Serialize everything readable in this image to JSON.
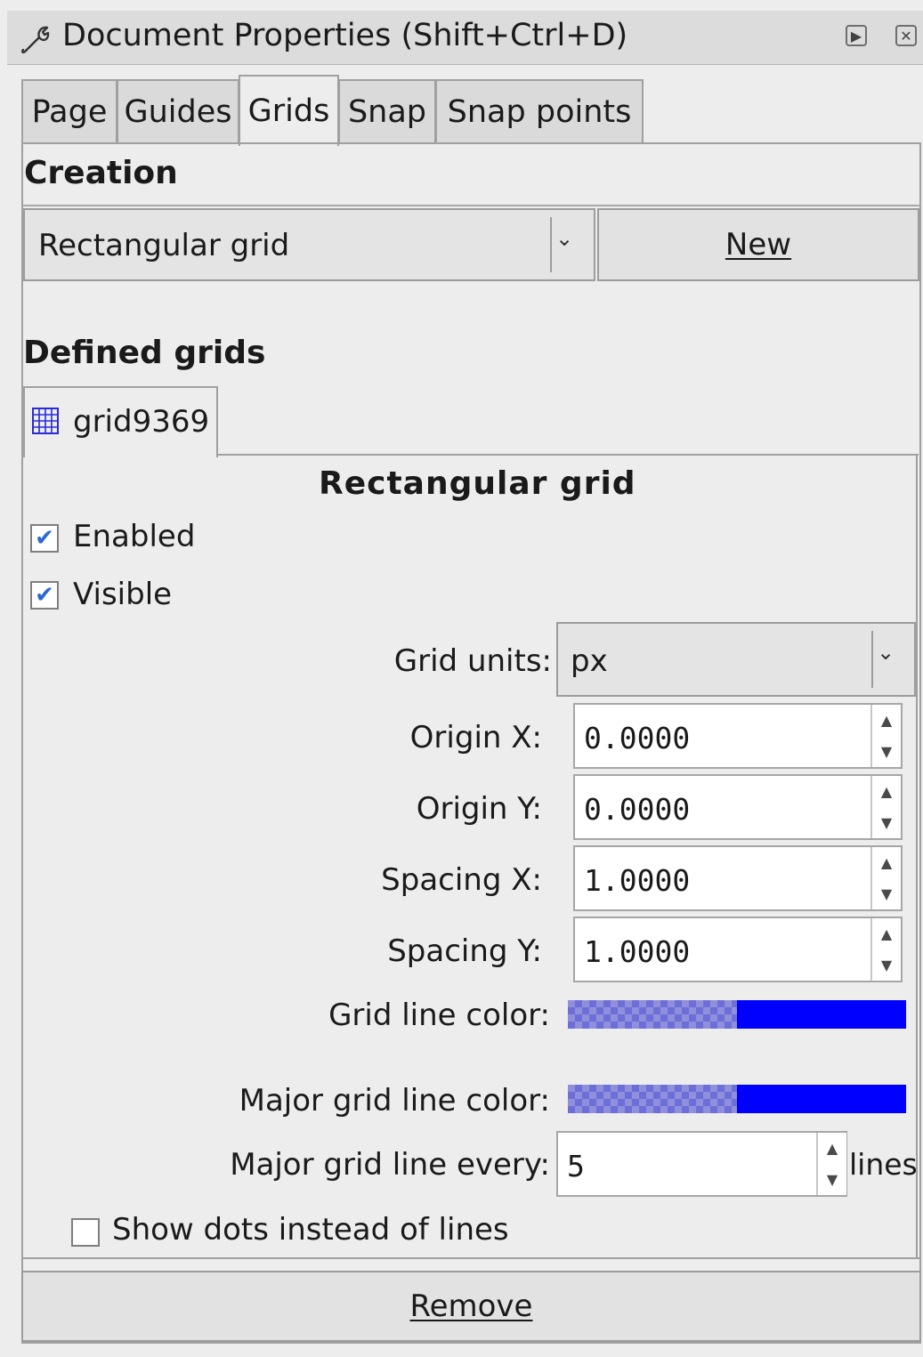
{
  "window": {
    "title": "Document Properties (Shift+Ctrl+D)",
    "icon": "wrench-icon"
  },
  "tabs": [
    {
      "label": "Page"
    },
    {
      "label": "Guides"
    },
    {
      "label": "Grids",
      "active": true
    },
    {
      "label": "Snap"
    },
    {
      "label": "Snap points"
    }
  ],
  "creation": {
    "heading": "Creation",
    "grid_type": "Rectangular grid",
    "new_label": "New"
  },
  "defined": {
    "heading": "Defined grids",
    "grid_tab": "grid9369",
    "grid_tab_icon": "grid-icon"
  },
  "grid": {
    "heading": "Rectangular grid",
    "enabled_label": "Enabled",
    "enabled": true,
    "visible_label": "Visible",
    "visible": true,
    "units_label": "Grid units:",
    "units_value": "px",
    "origin_x_label": "Origin X:",
    "origin_x": "0.0000",
    "origin_y_label": "Origin Y:",
    "origin_y": "0.0000",
    "spacing_x_label": "Spacing X:",
    "spacing_x": "1.0000",
    "spacing_y_label": "Spacing Y:",
    "spacing_y": "1.0000",
    "line_color_label": "Grid line color:",
    "line_color": "#0000ff",
    "major_color_label": "Major grid line color:",
    "major_color": "#0000ff",
    "major_every_label": "Major grid line every:",
    "major_every": "5",
    "major_every_unit": "lines",
    "dots_label": "Show dots instead of lines",
    "dots": false
  },
  "remove_label": "Remove"
}
